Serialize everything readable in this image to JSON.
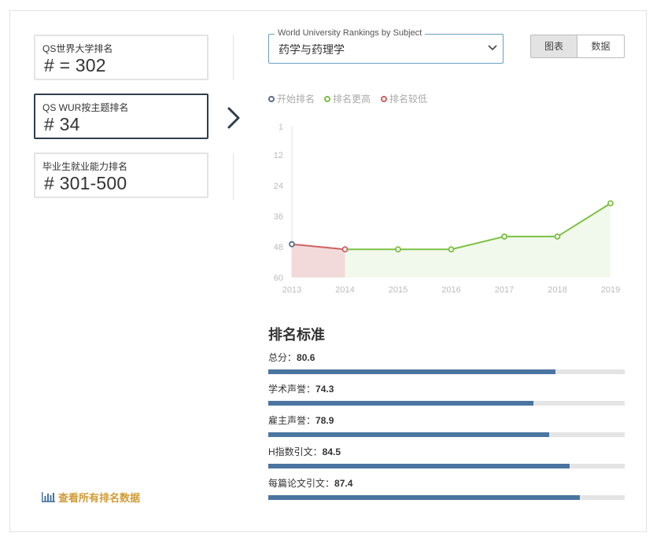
{
  "rank_cards": [
    {
      "label": "QS世界大学排名",
      "value": "# = 302",
      "active": false
    },
    {
      "label": "QS WUR按主题排名",
      "value": "# 34",
      "active": true
    },
    {
      "label": "毕业生就业能力排名",
      "value": "# 301-500",
      "active": false
    }
  ],
  "subject_select": {
    "legend": "World University Rankings by Subject",
    "value": "药学与药理学"
  },
  "view_toggle": {
    "chart_label": "图表",
    "data_label": "数据"
  },
  "chart_legend": [
    {
      "label": "开始排名",
      "color": "#5a6f86"
    },
    {
      "label": "排名更高",
      "color": "#7cc043"
    },
    {
      "label": "排名较低",
      "color": "#d0605f"
    }
  ],
  "chart_data": {
    "type": "line",
    "x": [
      2013,
      2014,
      2015,
      2016,
      2017,
      2018,
      2019
    ],
    "series": [
      {
        "values": [
          47,
          49,
          49,
          49,
          44,
          44,
          31
        ]
      }
    ],
    "y_ticks": [
      1,
      12,
      24,
      36,
      48,
      60
    ],
    "ylim": [
      1,
      60
    ],
    "y_inverted": true,
    "colors": {
      "start": "#5a6f86",
      "higher": "#7cc043",
      "lower": "#d0605f",
      "higher_fill": "#f1f9ec",
      "lower_fill": "#f3dada",
      "tick_text": "#bbbbbb"
    }
  },
  "criteria": {
    "title": "排名标准",
    "items": [
      {
        "label": "总分：",
        "value": "80.6",
        "score": 80.6
      },
      {
        "label": "学术声誉：",
        "value": "74.3",
        "score": 74.3
      },
      {
        "label": "雇主声誉：",
        "value": "78.9",
        "score": 78.9
      },
      {
        "label": "H指数引文：",
        "value": "84.5",
        "score": 84.5
      },
      {
        "label": "每篇论文引文：",
        "value": "87.4",
        "score": 87.4
      }
    ]
  },
  "view_all": {
    "label": "查看所有排名数据",
    "icon": "bar-chart-icon"
  }
}
